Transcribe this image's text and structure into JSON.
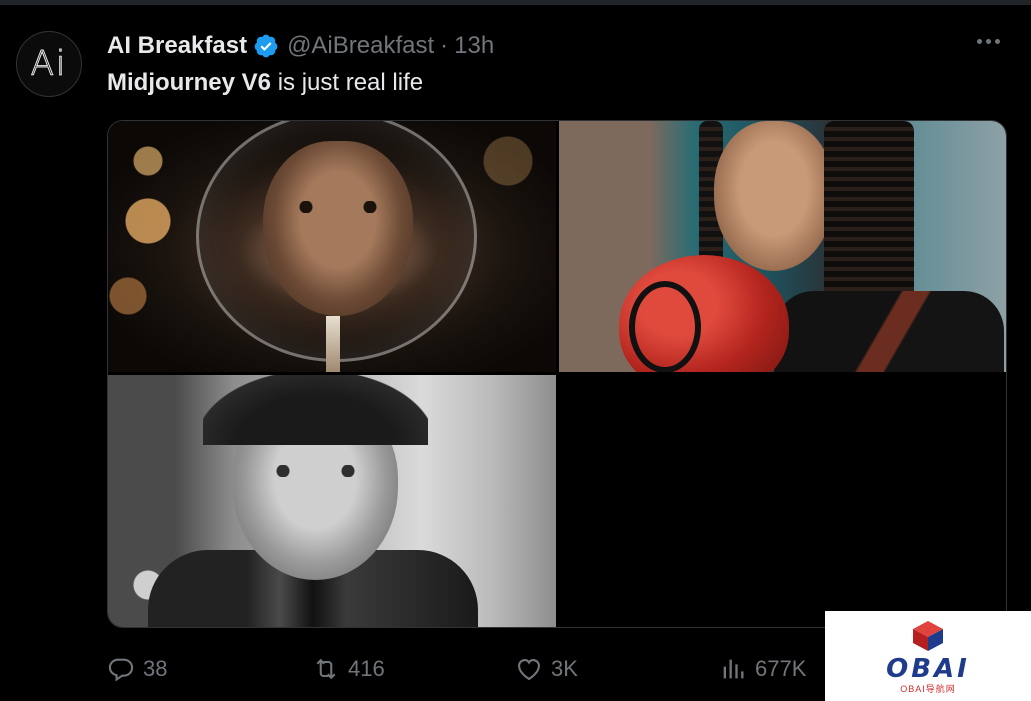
{
  "tweet": {
    "author_name": "AI Breakfast",
    "handle": "@AiBreakfast",
    "separator": "·",
    "time": "13h",
    "avatar_text": "Ai",
    "text_bold": "Midjourney V6",
    "text_rest": " is just real life"
  },
  "media": {
    "images": [
      {
        "name": "man-through-wine-glass"
      },
      {
        "name": "woman-boxer-with-braids"
      },
      {
        "name": "black-and-white-portrait-man"
      }
    ]
  },
  "actions": {
    "replies": "38",
    "retweets": "416",
    "likes": "3K",
    "views": "677K"
  },
  "watermark": {
    "title": "OBAI",
    "subtitle": "OBAI导航网"
  },
  "colors": {
    "background": "#000000",
    "text": "#e7e9ea",
    "muted": "#71767b",
    "verified": "#1d9bf0",
    "logo_blue": "#1f3c8c",
    "logo_red": "#d12b2b"
  },
  "icons": [
    "verified-badge-icon",
    "more-icon",
    "reply-icon",
    "retweet-icon",
    "like-icon",
    "views-icon",
    "obai-logo-icon"
  ]
}
